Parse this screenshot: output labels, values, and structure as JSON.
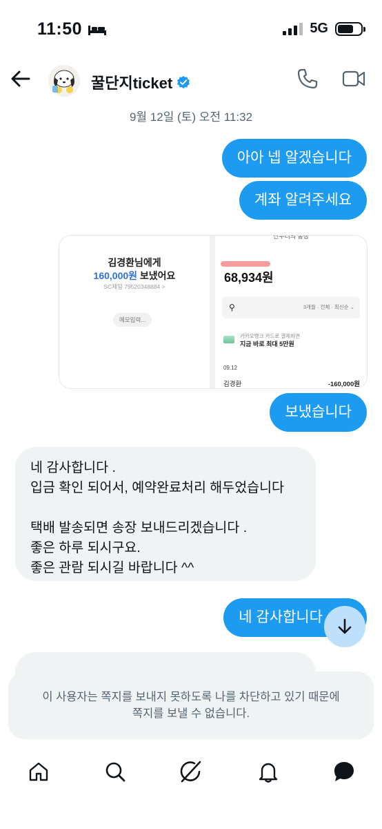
{
  "status_bar": {
    "time": "11:50",
    "network": "5G"
  },
  "header": {
    "name": "꿀단지ticket",
    "verified": true
  },
  "conversation": {
    "timestamp": "9월 12일 (토) 오전 11:32",
    "messages": [
      {
        "from": "me",
        "text": "아아 넵 알겠습니다"
      },
      {
        "from": "me",
        "text": "계좌 알려주세요"
      },
      {
        "from": "me",
        "text": "보냈습니다"
      },
      {
        "from": "them",
        "text": "네 감사합니다 .\n입금 확인 되어서, 예약완료처리 해두었습니다\n\n택배 발송되면 송장 보내드리겠습니다 .\n좋은 하루 되시구요.\n좋은 관람 되시길 바랍니다 ^^"
      },
      {
        "from": "me",
        "text": "네 감사합니다"
      }
    ],
    "attachment": {
      "left": {
        "line1": "김경환님에게",
        "amount": "160,000원",
        "suffix": " 보냈어요",
        "account": "SC제일 79520348884 >",
        "memo": "메모입력..."
      },
      "right": {
        "header": "전부터의 통장",
        "balance": "68,934원",
        "filter": "3개월 · 전체 · 최신순 ⌄",
        "card_line1": "카카오뱅크 카드로 결제하면",
        "card_line2": "지금 바로 최대 5만원",
        "date": "09.12",
        "tx_name": "김경환",
        "tx_amount": "-160,000원"
      }
    }
  },
  "blocked_notice": "이 사용자는 쪽지를 보내지 못하도록 나를 차단하고 있기 때문에\n쪽지를 보낼 수 없습니다.",
  "tab_bar": {
    "items": [
      "home-icon",
      "search-icon",
      "grok-icon",
      "bell-icon",
      "messages-icon"
    ]
  },
  "colors": {
    "accent": "#1d9bf0",
    "incoming_bubble": "#eff3f4",
    "secondary_text": "#536471"
  }
}
